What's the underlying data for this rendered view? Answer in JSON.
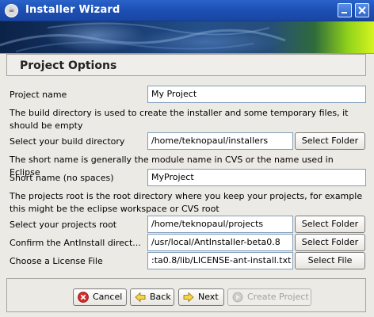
{
  "window": {
    "title": "Installer Wizard",
    "icon_name": "java-cup-icon"
  },
  "panel": {
    "title": "Project Options"
  },
  "form": {
    "project_name_label": "Project name",
    "project_name_value": "My Project",
    "build_dir_desc": "The build directory is used to create the installer and some temporary files, it should be empty",
    "build_dir_label": "Select your build directory",
    "build_dir_value": "/home/teknopaul/installers",
    "build_dir_button": "Select Folder",
    "short_name_desc": "The short name is generally the module name in CVS or the name used in Eclipse",
    "short_name_label": "Short name (no spaces)",
    "short_name_value": "MyProject",
    "projects_root_desc": "The projects root is the root directory where you keep your projects, for example this might be the eclipse workspace or CVS root",
    "projects_root_label": "Select your projects root",
    "projects_root_value": "/home/teknopaul/projects",
    "projects_root_button": "Select Folder",
    "antinstall_label": "Confirm the AntInstall direct...",
    "antinstall_value": "/usr/local/AntInstaller-beta0.8",
    "antinstall_button": "Select Folder",
    "license_label": "Choose a License File",
    "license_value": ":ta0.8/lib/LICENSE-ant-install.txt",
    "license_button": "Select File"
  },
  "nav": {
    "cancel": "Cancel",
    "back": "Back",
    "next": "Next",
    "create": "Create Project"
  },
  "colors": {
    "titlebar": "#1c4fb4",
    "window_bg": "#eceae5",
    "field_border": "#7f9db9",
    "disabled_text": "#a19f99"
  }
}
